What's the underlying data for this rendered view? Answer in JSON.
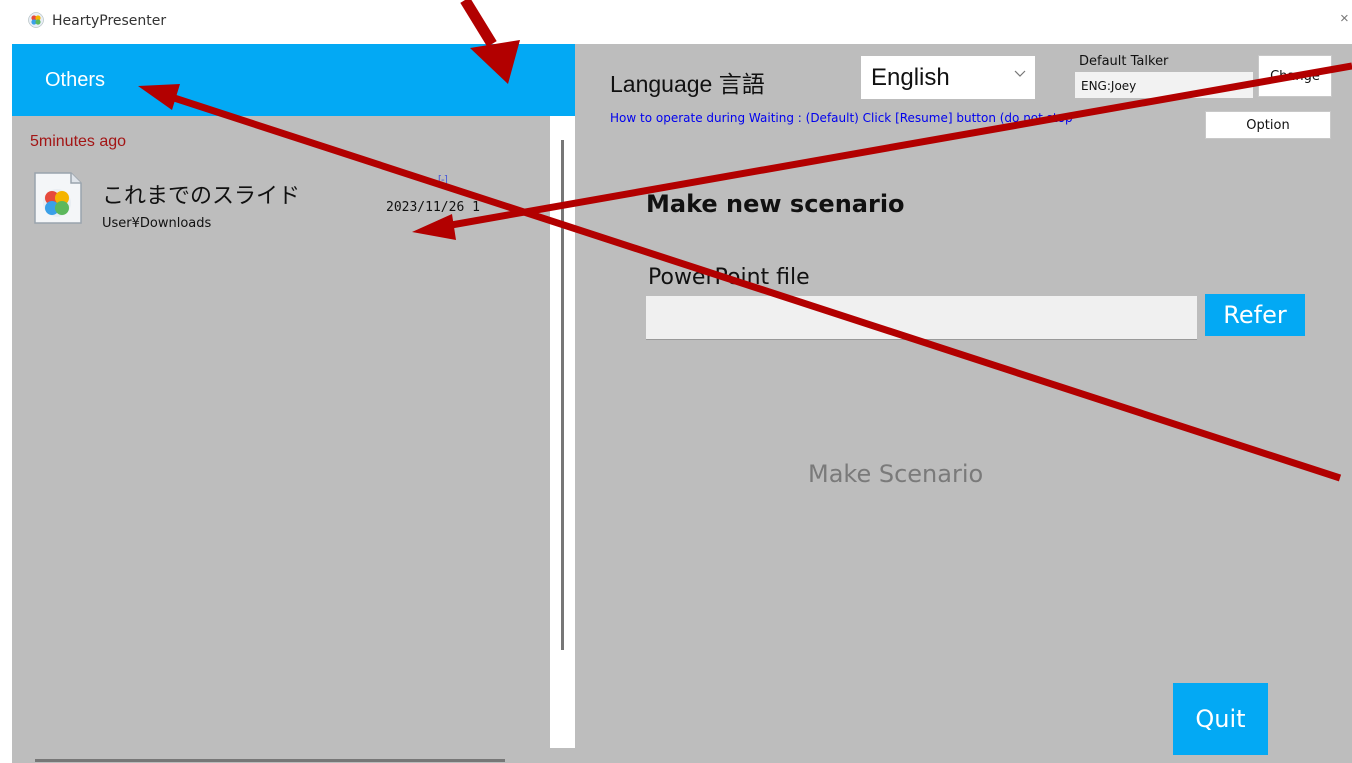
{
  "window": {
    "title": "HeartyPresenter",
    "close_glyph": "×"
  },
  "left": {
    "header_title": "Others",
    "groups": [
      {
        "label": "5minutes ago",
        "items": [
          {
            "name": "これまでのスライド",
            "path": "User¥Downloads",
            "date": "2023/11/26 1",
            "mark": "[-]",
            "icon": "hearty-presenter-file-icon"
          }
        ]
      }
    ]
  },
  "header": {
    "language_label": "Language 言語",
    "language_selected": "English",
    "default_talker_label": "Default Talker",
    "default_talker_value": "ENG:Joey",
    "change_button": "Change",
    "waiting_text": "How to operate during Waiting : (Default) Click [Resume] button (do not stop",
    "option_button": "Option"
  },
  "main": {
    "section_title": "Make new scenario",
    "file_label": "PowerPoint file",
    "file_value": "",
    "refer_button": "Refer",
    "make_button": "Make Scenario",
    "quit_button": "Quit"
  },
  "colors": {
    "accent": "#03a9f4",
    "panel": "#bdbdbd",
    "annotation_arrow": "#b20000",
    "group_label": "#a31515"
  }
}
